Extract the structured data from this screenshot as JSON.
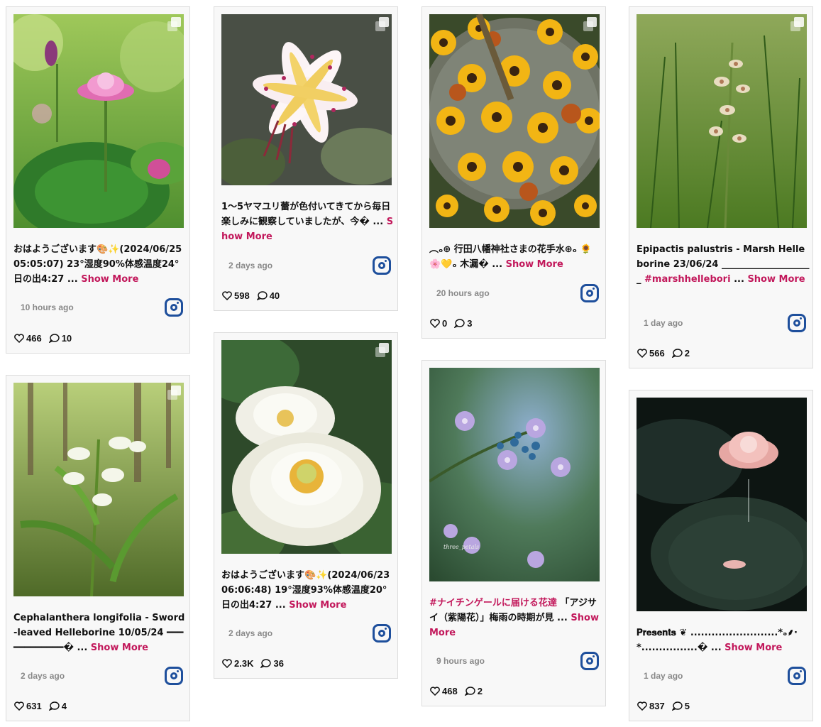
{
  "colors": {
    "accent": "#c2185b",
    "instagram": "#1e4f9c",
    "card_bg": "#f8f8f8",
    "meta": "#888888"
  },
  "cards": [
    {
      "image_desc": "pink lotus flower with large green lotus leaves",
      "caption": "おはようございます🎨✨(2024/06/25 05:05:07) 23°湿度90%体感温度24° 日の出4:27",
      "ellipsis": " ...",
      "show_more": "Show More",
      "time": "10 hours ago",
      "likes": "466",
      "comments": "10"
    },
    {
      "image_desc": "white yamayuri lily with red spots and yellow stripes",
      "caption": "1〜5ヤマユリ蕾が色付いてきてから毎日楽しみに観察していましたが、今�",
      "ellipsis": " ...",
      "show_more": "Show More",
      "time": "2 days ago",
      "likes": "598",
      "comments": "40"
    },
    {
      "image_desc": "sunflowers floating in a stone water basin",
      "caption": "︵ₒ⊕ 行田八幡神社さまの花手水⊕ₒ 🌻🌸💛ₒ 木漏�",
      "ellipsis": " ...",
      "show_more": "Show More",
      "time": "20 hours ago",
      "likes": "0",
      "comments": "3"
    },
    {
      "image_desc": "marsh helleborine orchid in green grass",
      "caption": "Epipactis palustris - Marsh Helleborine 23/06/24 ____________________",
      "hashtag": "#marshhellebori",
      "ellipsis": " ...",
      "show_more": "Show More",
      "time": "1 day ago",
      "likes": "566",
      "comments": "2"
    },
    {
      "image_desc": "white sword-leaved helleborine orchid in forest",
      "caption": "Cephalanthera longifolia - Sword-leaved Helleborine 10/05/24 ━━━━━━━━━━━━�",
      "ellipsis": " ...",
      "show_more": "Show More",
      "time": "2 days ago",
      "likes": "631",
      "comments": "4"
    },
    {
      "image_desc": "white double lotus with yellow center",
      "caption": "おはようございます🎨✨(2024/06/23 06:06:48) 19°湿度93%体感温度20° 日の出4:27",
      "ellipsis": " ...",
      "show_more": "Show More",
      "time": "2 days ago",
      "likes": "2.3K",
      "comments": "36"
    },
    {
      "image_desc": "lavender hydrangea blossoms with blurred background",
      "watermark": "three_petals",
      "hashtag": "#ナイチンゲールに届ける花達",
      "caption": " 「アジサイ（紫陽花）」梅雨の時期が見",
      "ellipsis": " ...",
      "show_more": "Show More",
      "time": "9 hours ago",
      "likes": "468",
      "comments": "2"
    },
    {
      "image_desc": "pink lotus over dark leaves with water droplet",
      "caption": "𝐏𝐫𝐞𝐬𝐞𝐧𝐭𝐬 ❦ .........................*ₔ⸙·*................�",
      "ellipsis": " ...",
      "show_more": "Show More",
      "time": "1 day ago",
      "likes": "837",
      "comments": "5"
    }
  ]
}
